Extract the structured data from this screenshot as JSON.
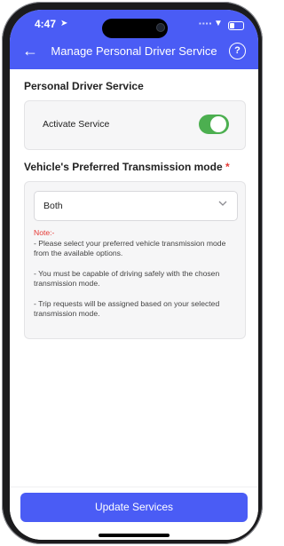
{
  "status_bar": {
    "time": "4:47",
    "location_arrow": "➤",
    "signal": "▪▪▪▪",
    "wifi": "▼"
  },
  "header": {
    "back_icon": "←",
    "title": "Manage Personal Driver Service",
    "help_icon": "?"
  },
  "section_service": {
    "heading": "Personal Driver Service",
    "toggle_label": "Activate Service",
    "toggle_on": true
  },
  "section_transmission": {
    "heading": "Vehicle's Preferred Transmission mode",
    "required_mark": "*",
    "select_value": "Both",
    "note_title": "Note:-",
    "note_lines": [
      "- Please select your preferred vehicle transmission mode from the available options.",
      "- You must be capable of driving safely with the chosen transmission mode.",
      "- Trip requests will be assigned based on your selected transmission mode."
    ]
  },
  "footer": {
    "button_label": "Update Services"
  },
  "colors": {
    "primary": "#4a5cf5",
    "toggle": "#4caf50",
    "required": "#e53935"
  }
}
